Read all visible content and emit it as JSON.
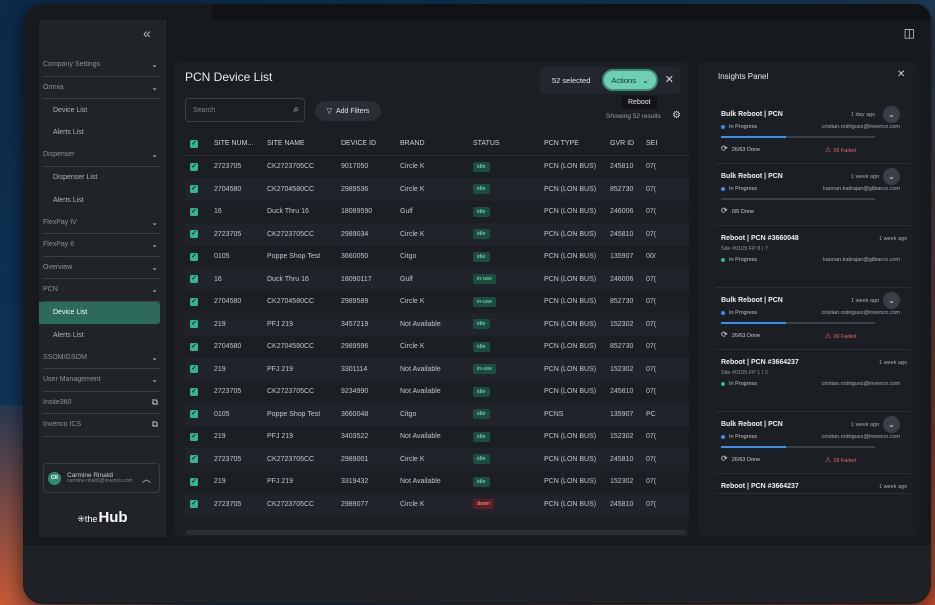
{
  "sidebar": {
    "collapse_icon": "«",
    "items": [
      {
        "label": "Company Settings",
        "kind": "group",
        "icon": "chevron-down"
      },
      {
        "label": "Omnia",
        "kind": "group",
        "icon": "chevron-down"
      },
      {
        "label": "Device List",
        "kind": "sub"
      },
      {
        "label": "Alerts List",
        "kind": "sub"
      },
      {
        "label": "Dispenser",
        "kind": "group",
        "icon": "chevron-down"
      },
      {
        "label": "Dispenser List",
        "kind": "sub"
      },
      {
        "label": "Alerts List",
        "kind": "sub"
      },
      {
        "label": "FlexPay IV",
        "kind": "group",
        "icon": "chevron-down"
      },
      {
        "label": "FlexPay 6",
        "kind": "group",
        "icon": "chevron-down"
      },
      {
        "label": "Overview",
        "kind": "group",
        "icon": "chevron-down"
      },
      {
        "label": "PCN",
        "kind": "group",
        "icon": "chevron-down"
      },
      {
        "label": "Device List",
        "kind": "active"
      },
      {
        "label": "Alerts List",
        "kind": "sub"
      },
      {
        "label": "SSOM/GSOM",
        "kind": "group",
        "icon": "chevron-down"
      },
      {
        "label": "User Management",
        "kind": "group",
        "icon": "chevron-down"
      },
      {
        "label": "Insite360",
        "kind": "group",
        "icon": "external-link"
      },
      {
        "label": "Invenco ICS",
        "kind": "group",
        "icon": "external-link"
      }
    ],
    "user": {
      "initials": "CR",
      "name": "Carmine Rinaldi",
      "email": "carmine.rinaldi@invenco.com"
    },
    "logo": {
      "mark": "⁜the",
      "text": "Hub"
    }
  },
  "main": {
    "title": "PCN Device List",
    "selected_text": "52 selected",
    "actions_label": "Actions",
    "tooltip": "Reboot",
    "search_placeholder": "Search",
    "add_filters": "Add Filters",
    "showing": "Showing 52 results",
    "columns": [
      "SITE NUM...",
      "SITE NAME",
      "DEVICE ID",
      "BRAND",
      "STATUS",
      "PCN TYPE",
      "GVR ID",
      "SEI"
    ],
    "rows": [
      [
        "2723705",
        "CK2723705CC",
        "9017050",
        "Circle K",
        "idle",
        "PCN (LON BUS)",
        "245810",
        "07("
      ],
      [
        "2704580",
        "CK2704580CC",
        "2989536",
        "Circle K",
        "idle",
        "PCN (LON BUS)",
        "852730",
        "07("
      ],
      [
        "16",
        "Duck Thru 16",
        "18089590",
        "Gulf",
        "idle",
        "PCN (LON BUS)",
        "246006",
        "07("
      ],
      [
        "2723705",
        "CK2723705CC",
        "2989034",
        "Circle K",
        "idle",
        "PCN (LON BUS)",
        "245810",
        "07("
      ],
      [
        "0105",
        "Poppe Shop Test",
        "3660050",
        "Citgo",
        "idle",
        "PCN (LON BUS)",
        "135907",
        "00/"
      ],
      [
        "16",
        "Duck Thru 16",
        "18090117",
        "Gulf",
        "in-use",
        "PCN (LON BUS)",
        "246006",
        "07("
      ],
      [
        "2704580",
        "CK2704580CC",
        "2989589",
        "Circle K",
        "in-use",
        "PCN (LON BUS)",
        "852730",
        "07("
      ],
      [
        "219",
        "PFJ 219",
        "3457219",
        "Not Available",
        "idle",
        "PCN (LON BUS)",
        "152302",
        "07("
      ],
      [
        "2704580",
        "CK2704580CC",
        "2989596",
        "Circle K",
        "idle",
        "PCN (LON BUS)",
        "852730",
        "07("
      ],
      [
        "219",
        "PFJ 219",
        "3301114",
        "Not Available",
        "in-use",
        "PCN (LON BUS)",
        "152302",
        "07("
      ],
      [
        "2723705",
        "CK2723705CC",
        "9234990",
        "Not Available",
        "idle",
        "PCN (LON BUS)",
        "245810",
        "07("
      ],
      [
        "0105",
        "Poppe Shop Test",
        "3660048",
        "Citgo",
        "idle",
        "PCNS",
        "135907",
        "PC"
      ],
      [
        "219",
        "PFJ 219",
        "3403522",
        "Not Available",
        "idle",
        "PCN (LON BUS)",
        "152302",
        "07("
      ],
      [
        "2723705",
        "CK2723705CC",
        "2989001",
        "Circle K",
        "idle",
        "PCN (LON BUS)",
        "245810",
        "07("
      ],
      [
        "219",
        "PFJ 219",
        "3319432",
        "Not Available",
        "idle",
        "PCN (LON BUS)",
        "152302",
        "07("
      ],
      [
        "2723705",
        "CK2723705CC",
        "2989077",
        "Circle K",
        "down",
        "PCN (LON BUS)",
        "245810",
        "07("
      ]
    ]
  },
  "insights": {
    "title": "Insights Panel",
    "items": [
      {
        "name": "Bulk Reboot | PCN",
        "time": "1 day ago",
        "status": "In Progress",
        "email": "cristian.rodriguez@invenco.com",
        "progress": 0.42,
        "done": "26/63 Done",
        "failed": "26 Failed",
        "expand": true
      },
      {
        "name": "Bulk Reboot | PCN",
        "time": "1 week ago",
        "status": "In Progress",
        "email": "kannan.kalirajan@gilbarco.com",
        "progress": 0.0,
        "done": "0/6 Done",
        "failed": "",
        "expand": true
      },
      {
        "name": "Reboot | PCN #3660048",
        "time": "1 week ago",
        "site": "Site #0105 FP 8 | 7",
        "status": "In Progress",
        "email": "kannan.kalirajan@gilbarco.com",
        "dot": "green"
      },
      {
        "name": "Bulk Reboot | PCN",
        "time": "1 week ago",
        "status": "In Progress",
        "email": "cristian.rodriguez@invenco.com",
        "progress": 0.42,
        "done": "26/63 Done",
        "failed": "26 Failed",
        "expand": true
      },
      {
        "name": "Reboot | PCN #3664237",
        "time": "1 week ago",
        "site": "Site #0105 FP 1 | 2",
        "status": "In Progress",
        "email": "cristian.rodriguez@invenco.com",
        "dot": "green"
      },
      {
        "name": "Bulk Reboot | PCN",
        "time": "1 week ago",
        "status": "In Progress",
        "email": "cristian.rodriguez@invenco.com",
        "progress": 0.42,
        "done": "26/63 Done",
        "failed": "26 Failed",
        "expand": true
      },
      {
        "name": "Reboot | PCN #3664237",
        "time": "1 week ago"
      }
    ]
  },
  "colors": {
    "accent": "#35b58f",
    "actions_bg": "#6fcfb4",
    "progress": "#3d8ef0",
    "failed": "#e66a6a"
  }
}
